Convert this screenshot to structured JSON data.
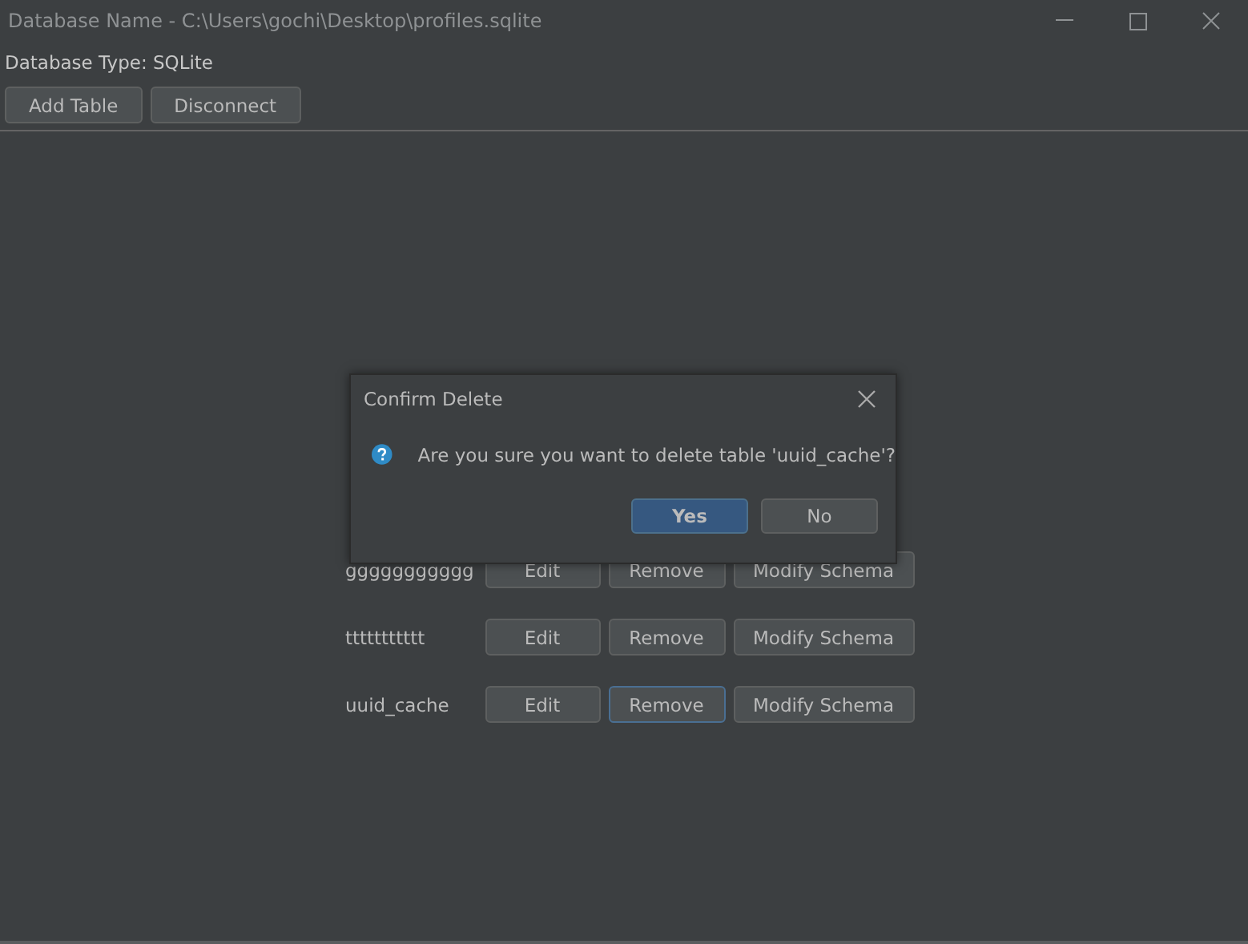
{
  "window": {
    "title": "Database Name - C:\\Users\\gochi\\Desktop\\profiles.sqlite"
  },
  "database_type": "Database Type: SQLite",
  "toolbar": [
    "Add Table",
    "Disconnect"
  ],
  "tables": [
    {
      "name": "ggggggggggg",
      "buttons": [
        {
          "label": "Edit",
          "focused": false
        },
        {
          "label": "Remove",
          "focused": false
        },
        {
          "label": "Modify Schema",
          "focused": false
        }
      ]
    },
    {
      "name": "ttttttttttt",
      "buttons": [
        {
          "label": "Edit",
          "focused": false
        },
        {
          "label": "Remove",
          "focused": false
        },
        {
          "label": "Modify Schema",
          "focused": false
        }
      ]
    },
    {
      "name": "uuid_cache",
      "buttons": [
        {
          "label": "Edit",
          "focused": false
        },
        {
          "label": "Remove",
          "focused": true
        },
        {
          "label": "Modify Schema",
          "focused": false
        }
      ]
    }
  ],
  "dialog": {
    "title": "Confirm Delete",
    "message": "Are you sure you want to delete table 'uuid_cache'?",
    "buttons": [
      {
        "label": "Yes",
        "default": true
      },
      {
        "label": "No",
        "default": false
      }
    ]
  }
}
